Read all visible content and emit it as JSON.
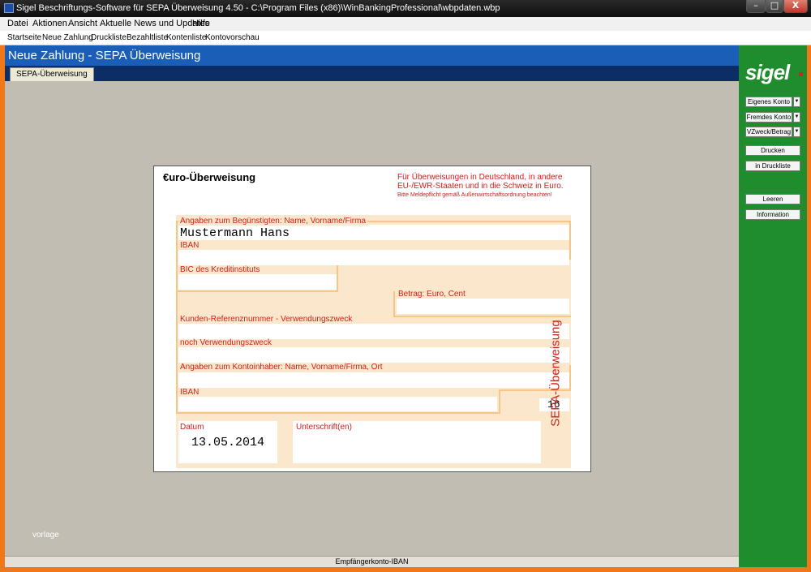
{
  "window": {
    "title": "Sigel Beschriftungs-Software für SEPA Überweisung 4.50 - C:\\Program Files (x86)\\WinBankingProfessional\\wbpdaten.wbp",
    "controls": {
      "minimize": "–",
      "maximize": "□",
      "close": "X"
    }
  },
  "menu": [
    "Datei",
    "Aktionen",
    "Ansicht",
    "Aktuelle News und Updates",
    "Hilfe"
  ],
  "toolbar": [
    "Startseite",
    "Neue Zahlung",
    "Druckliste",
    "Bezahltliste",
    "Kontenliste",
    "Kontovorschau"
  ],
  "page": {
    "header": "Neue Zahlung - SEPA Überweisung",
    "tab": "SEPA-Überweisung",
    "watermark": "vorlage",
    "status": "Empfängerkonto-IBAN"
  },
  "form": {
    "heading": "€uro-Überweisung",
    "note_lines": [
      "Für Überweisungen in Deutschland, in andere",
      "EU-/EWR-Staaten und in die Schweiz in Euro.",
      "Bitte Meldepflicht gemäß Außenwirtschaftsordnung beachten!"
    ],
    "vertical_title": "SEPA-Überweisung",
    "labels": {
      "beneficiary": "Angaben zum Begünstigten: Name, Vorname/Firma",
      "iban": "IBAN",
      "bic": "BIC des Kreditinstituts",
      "amount": "Betrag: Euro, Cent",
      "reference": "Kunden-Referenznummer - Verwendungszweck",
      "reference2": "noch Verwendungszweck",
      "payer": "Angaben zum Kontoinhaber: Name, Vorname/Firma, Ort",
      "payer_iban": "IBAN",
      "date": "Datum",
      "signature": "Unterschrift(en)"
    },
    "values": {
      "beneficiary": "Mustermann Hans",
      "iban": "",
      "bic": "",
      "amount": "",
      "reference": "",
      "reference2": "",
      "payer": "",
      "payer_iban": "",
      "code": "16",
      "date": "13.05.2014",
      "signature": ""
    }
  },
  "sidebar": {
    "logo": "sigel",
    "dropdowns": [
      "Eigenes Konto",
      "Fremdes Konto",
      "VZweck/Betrag"
    ],
    "buttons": [
      "Drucken",
      "in Druckliste",
      "Leeren",
      "Information"
    ],
    "arrow_glyph": "▼"
  },
  "colors": {
    "accent_blue": "#1a5eb8",
    "sidebar_green": "#1f8c2e",
    "frame_orange": "#f07818",
    "form_red": "#d0201c",
    "slip_beige": "#fbe8cc"
  }
}
